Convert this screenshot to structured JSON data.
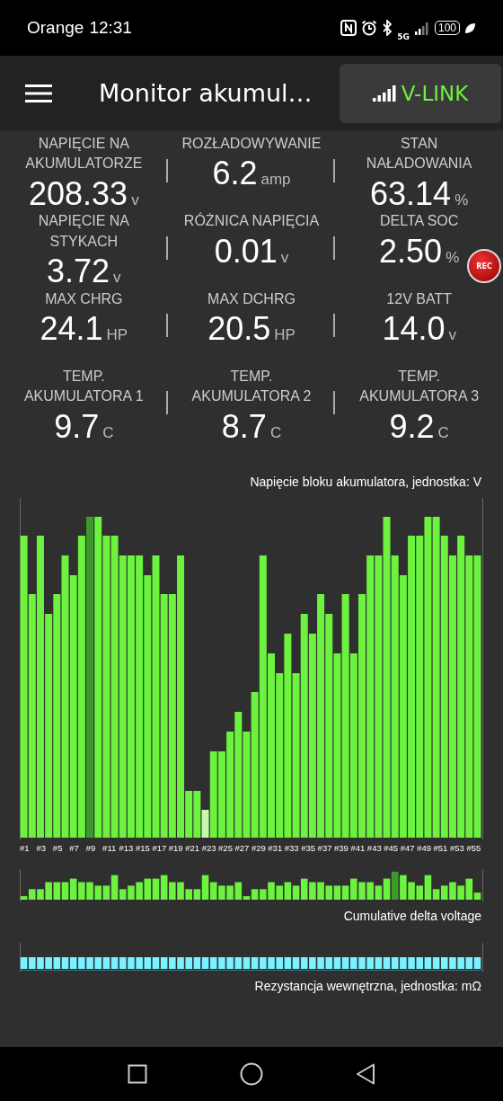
{
  "status_bar": {
    "carrier": "Orange",
    "time": "12:31",
    "network": "5G",
    "battery": "100"
  },
  "header": {
    "title": "Monitor akumul…",
    "link_button": "V-LINK"
  },
  "metrics": [
    {
      "label": "NAPIĘCIE NA AKUMULATORZE",
      "value": "208.33",
      "unit": "v"
    },
    {
      "label": "ROZŁADOWYWANIE",
      "value": "6.2",
      "unit": "amp"
    },
    {
      "label": "STAN NAŁADOWANIA",
      "value": "63.14",
      "unit": "%"
    },
    {
      "label": "NAPIĘCIE NA STYKACH",
      "value": "3.72",
      "unit": "v"
    },
    {
      "label": "RÓŻNICA NAPIĘCIA",
      "value": "0.01",
      "unit": "v"
    },
    {
      "label": "DELTA SOC",
      "value": "2.50",
      "unit": "%"
    },
    {
      "label": "MAX CHRG",
      "value": "24.1",
      "unit": "HP"
    },
    {
      "label": "MAX DCHRG",
      "value": "20.5",
      "unit": "HP"
    },
    {
      "label": "12V BATT",
      "value": "14.0",
      "unit": "v"
    },
    {
      "label": "TEMP. AKUMULATORA 1",
      "value": "9.7",
      "unit": "C"
    },
    {
      "label": "TEMP. AKUMULATORA 2",
      "value": "8.7",
      "unit": "C"
    },
    {
      "label": "TEMP. AKUMULATORA 3",
      "value": "9.2",
      "unit": "C"
    }
  ],
  "rec_button": "REC",
  "cell_voltage_chart": {
    "title": "Napięcie bloku akumulatora, jednostka: V",
    "labels": [
      "#1",
      "#3",
      "#5",
      "#7",
      "#9",
      "#11",
      "#13",
      "#15",
      "#17",
      "#19",
      "#21",
      "#23",
      "#25",
      "#27",
      "#29",
      "#31",
      "#33",
      "#35",
      "#37",
      "#39",
      "#41",
      "#43",
      "#45",
      "#47",
      "#49",
      "#51",
      "#53",
      "#55"
    ]
  },
  "delta_chart": {
    "caption": "Cumulative delta voltage"
  },
  "resistance_chart": {
    "caption": "Rezystancja wewnętrzna, jednostka: mΩ"
  }
}
